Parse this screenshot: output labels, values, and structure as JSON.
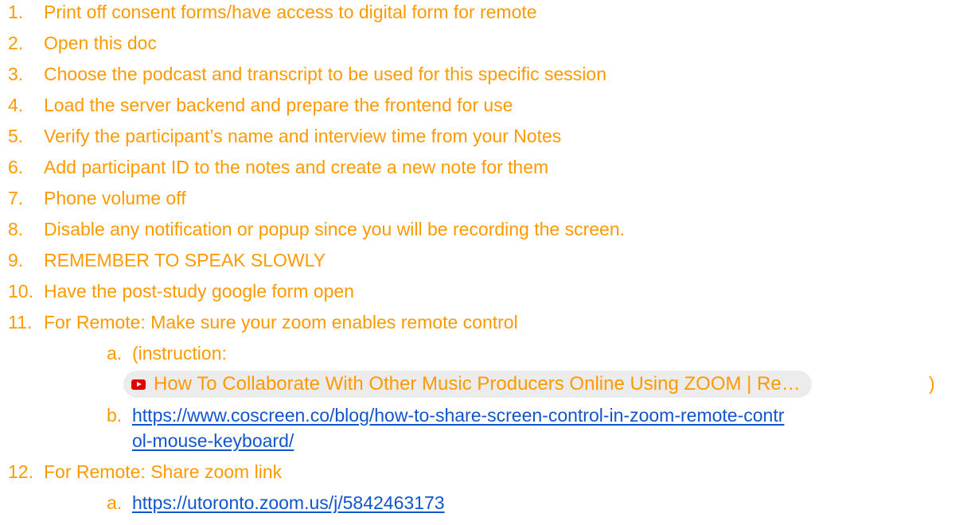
{
  "list": {
    "items": [
      {
        "num": "1.",
        "text": "Print off consent forms/have access to digital form for remote"
      },
      {
        "num": "2.",
        "text": "Open this doc"
      },
      {
        "num": "3.",
        "text": "Choose the podcast and transcript to be used for this specific session"
      },
      {
        "num": "4.",
        "text": "Load the server backend and prepare the frontend for use"
      },
      {
        "num": "5.",
        "text": "Verify the participant’s name and interview time from your Notes"
      },
      {
        "num": "6.",
        "text": "Add participant ID to the notes and create a new note for them"
      },
      {
        "num": "7.",
        "text": "Phone volume off"
      },
      {
        "num": "8.",
        "text": "Disable any notification or popup since you will be recording the screen."
      },
      {
        "num": "9.",
        "text": "REMEMBER TO SPEAK SLOWLY"
      },
      {
        "num": "10.",
        "text": "Have the post-study google form open"
      },
      {
        "num": "11.",
        "text": "For Remote: Make sure your zoom enables remote control"
      },
      {
        "num": "12.",
        "text": "For Remote: Share zoom link"
      }
    ],
    "sub11": {
      "a_num": "a.",
      "a_text": "(instruction:",
      "chip_label": "How To Collaborate With Other Music Producers Online Using ZOOM | Re…",
      "chip_icon": "youtube-icon",
      "chip_after": ")",
      "b_num": "b.",
      "b_link_line1": "https://www.coscreen.co/blog/how-to-share-screen-control-in-zoom-remote-contr",
      "b_link_line2": "ol-mouse-keyboard/"
    },
    "sub12": {
      "a_num": "a.",
      "a_link": "https://utoronto.zoom.us/j/5842463173"
    }
  },
  "colors": {
    "text_orange": "#ff9900",
    "link_blue": "#1155cc",
    "chip_bg": "#ececec",
    "youtube_red": "#e10000"
  }
}
